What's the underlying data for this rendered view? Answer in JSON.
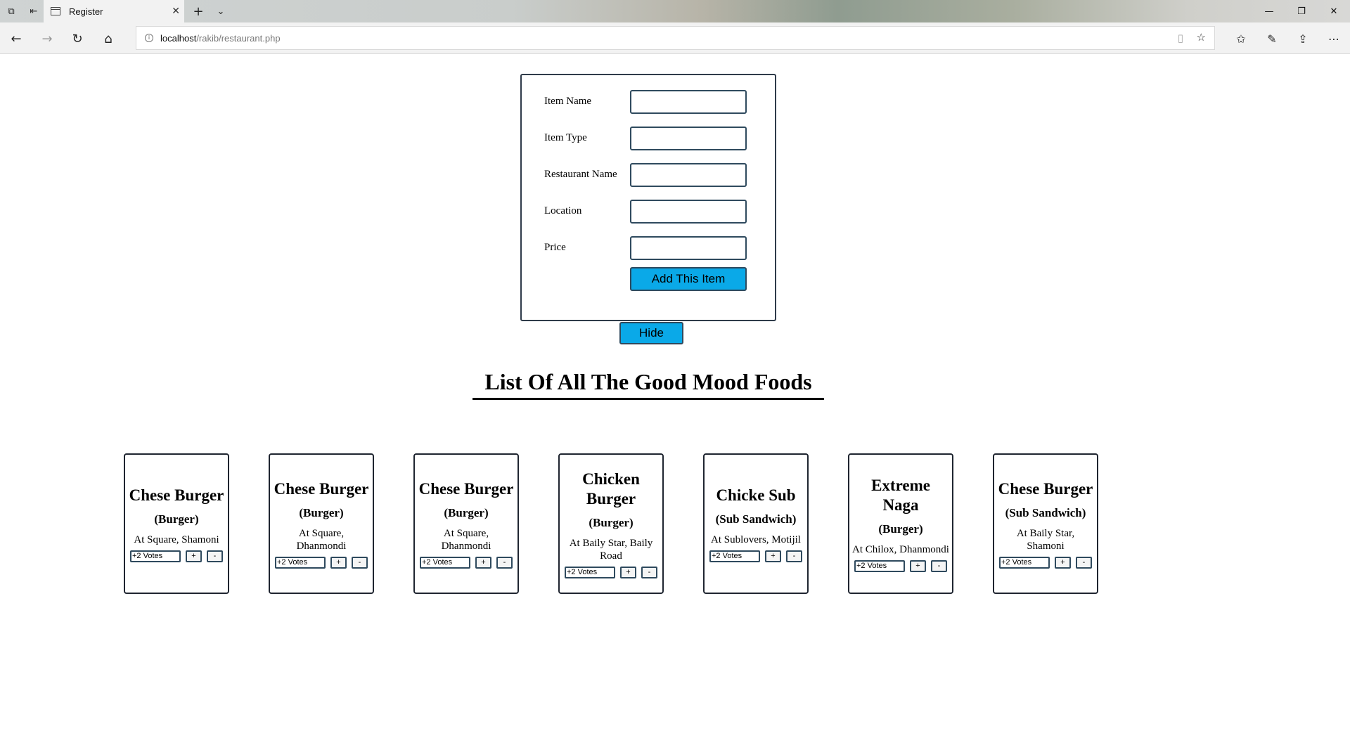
{
  "browser": {
    "tab_title": "Register",
    "url_host": "localhost",
    "url_path": "/rakib/restaurant.php"
  },
  "form": {
    "fields": [
      {
        "label": "Item Name",
        "value": ""
      },
      {
        "label": "Item Type",
        "value": ""
      },
      {
        "label": "Restaurant Name",
        "value": ""
      },
      {
        "label": "Location",
        "value": ""
      },
      {
        "label": "Price",
        "value": ""
      }
    ],
    "submit_label": "Add This Item"
  },
  "hide_label": "Hide",
  "list_title": "List Of All The Good Mood Foods",
  "items": [
    {
      "name": "Chese Burger",
      "type": "(Burger)",
      "location": "At Square, Shamoni",
      "votes": "+2 Votes",
      "up": "+",
      "down": "-"
    },
    {
      "name": "Chese Burger",
      "type": "(Burger)",
      "location": "At Square, Dhanmondi",
      "votes": "+2 Votes",
      "up": "+",
      "down": "-"
    },
    {
      "name": "Chese Burger",
      "type": "(Burger)",
      "location": "At Square, Dhanmondi",
      "votes": "+2 Votes",
      "up": "+",
      "down": "-"
    },
    {
      "name": "Chicken Burger",
      "type": "(Burger)",
      "location": "At Baily Star, Baily Road",
      "votes": "+2 Votes",
      "up": "+",
      "down": "-"
    },
    {
      "name": "Chicke Sub",
      "type": "(Sub Sandwich)",
      "location": "At Sublovers, Motijil",
      "votes": "+2 Votes",
      "up": "+",
      "down": "-"
    },
    {
      "name": "Extreme Naga",
      "type": "(Burger)",
      "location": "At Chilox, Dhanmondi",
      "votes": "+2 Votes",
      "up": "+",
      "down": "-"
    },
    {
      "name": "Chese Burger",
      "type": "(Sub Sandwich)",
      "location": "At Baily Star, Shamoni",
      "votes": "+2 Votes",
      "up": "+",
      "down": "-"
    }
  ]
}
